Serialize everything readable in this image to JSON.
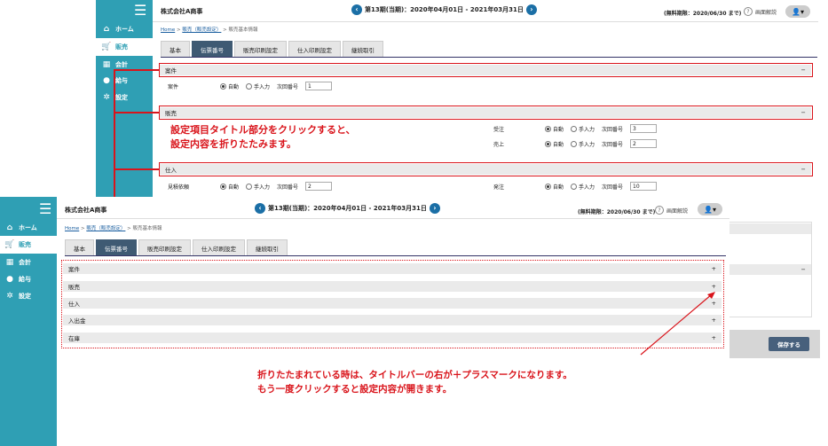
{
  "company": "株式会社A商事",
  "period": "第13期(当期)：2020年04月01日 - 2021年03月31日",
  "trial": "(無料期限：2020/06/30 まで)",
  "help": "画面解説",
  "user_icon": "user-icon",
  "sidebar": {
    "menu_icon": "hamburger-icon",
    "items": [
      {
        "label": "ホーム",
        "icon": "home-icon",
        "glyph": "⌂"
      },
      {
        "label": "販売",
        "icon": "cart-icon",
        "glyph": "🛒"
      },
      {
        "label": "会計",
        "icon": "calculator-icon",
        "glyph": "▦"
      },
      {
        "label": "給与",
        "icon": "moneybag-icon",
        "glyph": "●"
      },
      {
        "label": "設定",
        "icon": "gear-icon",
        "glyph": "✲"
      }
    ]
  },
  "breadcrumb": {
    "home": "Home",
    "sales": "販売（販売設定）",
    "current": "販売基本情報"
  },
  "tabs": [
    "基本",
    "伝票番号",
    "販売印刷設定",
    "仕入印刷設定",
    "継続取引"
  ],
  "back_sections": {
    "anken": {
      "title": "案件",
      "toggle": "−",
      "label": "案件",
      "auto": "自動",
      "manual": "手入力",
      "next": "次回番号",
      "value": "1"
    },
    "hanbai": {
      "title": "販売",
      "toggle": "−",
      "rows": [
        {
          "label": "受注",
          "auto": "自動",
          "manual": "手入力",
          "next": "次回番号",
          "value": "3"
        },
        {
          "label": "売上",
          "auto": "自動",
          "manual": "手入力",
          "next": "次回番号",
          "value": "2"
        }
      ]
    },
    "shiire": {
      "title": "仕入",
      "toggle": "−",
      "rows": [
        {
          "label": "見積依頼",
          "auto": "自動",
          "manual": "手入力",
          "next": "次回番号",
          "value": "2"
        },
        {
          "label": "発注",
          "auto": "自動",
          "manual": "手入力",
          "next": "次回番号",
          "value": "10"
        }
      ]
    },
    "extra_toggle": "−"
  },
  "front_sections": [
    {
      "title": "案件",
      "toggle": "+"
    },
    {
      "title": "販売",
      "toggle": "+"
    },
    {
      "title": "仕入",
      "toggle": "+"
    },
    {
      "title": "入出金",
      "toggle": "+"
    },
    {
      "title": "在庫",
      "toggle": "+"
    }
  ],
  "save_label": "保存する",
  "annotation1": [
    "設定項目タイトル部分をクリックすると、",
    "設定内容を折りたたみます。"
  ],
  "annotation2": [
    "折りたたまれている時は、タイトルバーの右が＋プラスマークになります。",
    "もう一度クリックすると設定内容が開きます。"
  ],
  "colors": {
    "sidebar": "#2f9fb4",
    "accent_red": "#d9141b",
    "tab_active": "#3f5a73",
    "nav_blue": "#1b6fa6"
  }
}
